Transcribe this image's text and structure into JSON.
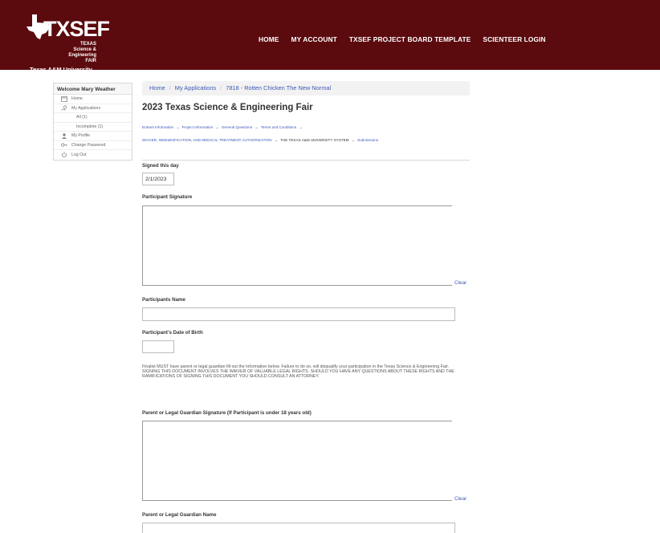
{
  "brand": {
    "title": "TXSEF",
    "subtitle_line1": "TEXAS Science &",
    "subtitle_line2": "Engineering FAIR",
    "university": "Texas A&M University"
  },
  "nav": [
    {
      "label": "HOME"
    },
    {
      "label": "MY ACCOUNT"
    },
    {
      "label": "TXSEF PROJECT BOARD TEMPLATE"
    },
    {
      "label": "SCIENTEER LOGIN"
    }
  ],
  "sidebar": {
    "welcome": "Welcome Mary Weather",
    "items": [
      {
        "label": "Home",
        "icon": "home-icon"
      },
      {
        "label": "My Applications",
        "icon": "applications-icon"
      },
      {
        "label": "All (1)",
        "icon": ""
      },
      {
        "label": "Incomplete (1)",
        "icon": ""
      },
      {
        "label": "My Profile",
        "icon": "user-icon"
      },
      {
        "label": "Change Password",
        "icon": "key-icon"
      },
      {
        "label": "Log Out",
        "icon": "power-icon"
      }
    ]
  },
  "breadcrumb": [
    "Home",
    "My Applications",
    "7818 - Rotten Chicken The New Normal"
  ],
  "page_title": "2023 Texas Science & Engineering Fair",
  "steps": {
    "row1": [
      "Entrant Information",
      "Project Information",
      "General Questions",
      "Terms and Conditions"
    ],
    "row2": [
      "WAIVER, INDEMNIFICATION, AND MEDICAL TREATMENT AUTHORIZATION",
      "THE TEXAS A&M UNIVERSITY SYSTEM",
      "Submissions"
    ]
  },
  "form": {
    "signed_label": "Signed this day",
    "signed_value": "2/1/2023",
    "participant_signature_label": "Participant Signature",
    "clear_label": "Clear",
    "participant_name_label": "Participants Name",
    "participant_name_value": "",
    "dob_label": "Participant's Date of Birth",
    "dob_value": "",
    "notice": "Finalist MUST have parent or legal guardian fill out the information below. Failure to do so, will disqualify your participation in the Texas Science & Engineering Fair. SIGNING THIS DOCUMENT INVOLVES THE WAIVER OF VALUABLE LEGAL RIGHTS. SHOULD YOU HAVE ANY QUESTIONS ABOUT THESE RIGHTS AND THE RAMIFICATIONS OF SIGNING THIS DOCUMENT YOU SHOULD CONSULT AN ATTORNEY.",
    "guardian_signature_label": "Parent or Legal Guardian Signature (If Participant is under 18 years old)",
    "guardian_name_label": "Parent or Legal Guardian Name",
    "guardian_name_value": ""
  },
  "colors": {
    "header_bg": "#5b0a0e",
    "link": "#3d59b7"
  }
}
